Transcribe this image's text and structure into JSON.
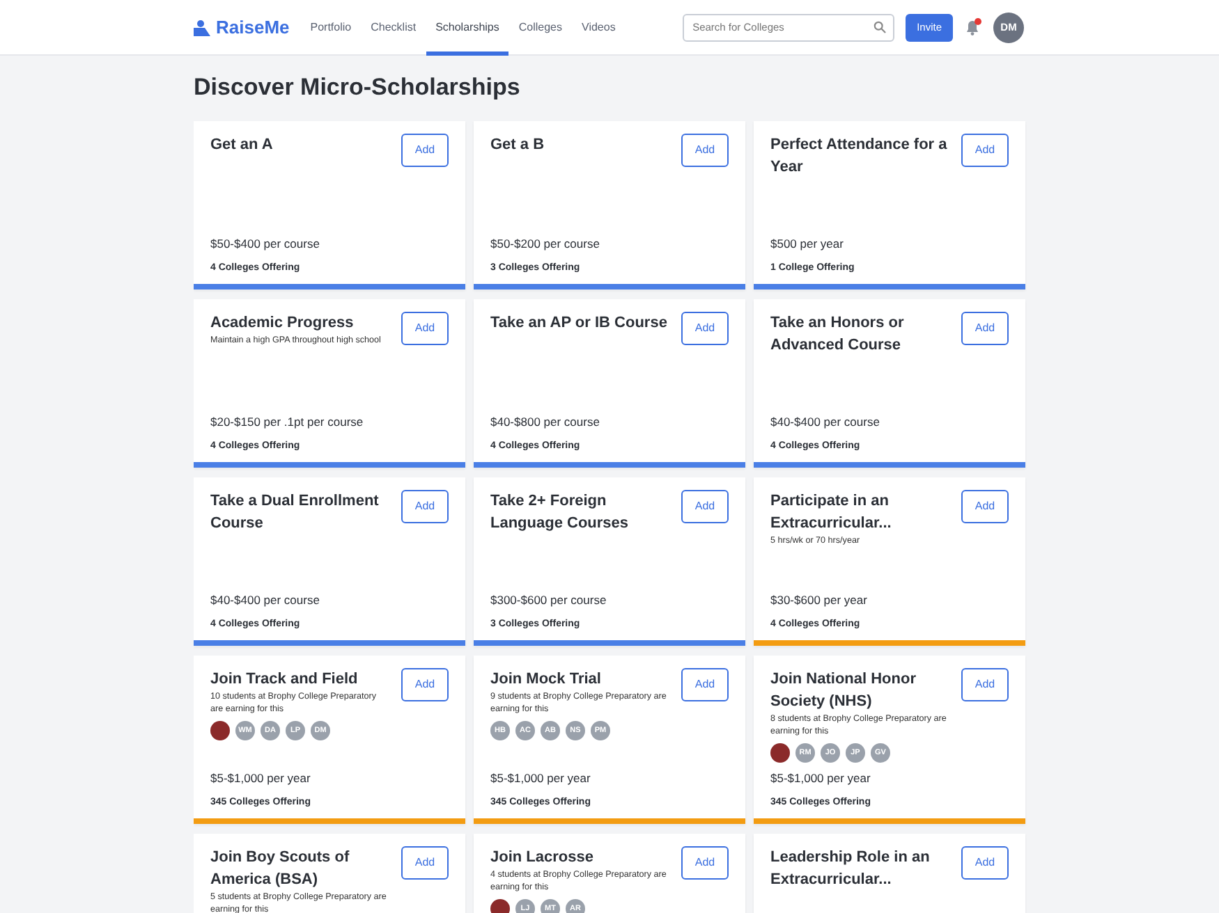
{
  "brand": "RaiseMe",
  "nav": [
    {
      "label": "Portfolio",
      "selected": false
    },
    {
      "label": "Checklist",
      "selected": false
    },
    {
      "label": "Scholarships",
      "selected": true
    },
    {
      "label": "Colleges",
      "selected": false
    },
    {
      "label": "Videos",
      "selected": false
    }
  ],
  "search": {
    "placeholder": "Search for Colleges"
  },
  "invite": "Invite",
  "notifications": {
    "unread": true
  },
  "user_initials": "DM",
  "heading": "Discover Micro-Scholarships",
  "cards": [
    {
      "title": "Get an A",
      "button": "Add",
      "amount": "$50-$400 per course",
      "offering": "4 Colleges Offering",
      "color": "#4a7fe6"
    },
    {
      "title": "Get a B",
      "button": "Add",
      "amount": "$50-$200 per course",
      "offering": "3 Colleges Offering",
      "color": "#4a7fe6"
    },
    {
      "title": "Perfect Attendance for a Year",
      "button": "Add",
      "amount": "$500 per year",
      "offering": "1 College Offering",
      "color": "#4a7fe6"
    },
    {
      "title": "Academic Progress",
      "subtitle": "Maintain a high GPA throughout high school",
      "button": "Add",
      "amount": "$20-$150 per .1pt per course",
      "offering": "4 Colleges Offering",
      "color": "#4a7fe6"
    },
    {
      "title": "Take an AP or IB Course",
      "button": "Add",
      "amount": "$40-$800 per course",
      "offering": "4 Colleges Offering",
      "color": "#4a7fe6"
    },
    {
      "title": "Take an Honors or Advanced Course",
      "button": "Add",
      "amount": "$40-$400 per course",
      "offering": "4 Colleges Offering",
      "color": "#4a7fe6"
    },
    {
      "title": "Take a Dual Enrollment Course",
      "button": "Add",
      "amount": "$40-$400 per course",
      "offering": "4 Colleges Offering",
      "color": "#4a7fe6"
    },
    {
      "title": "Take 2+ Foreign Language Courses",
      "button": "Add",
      "amount": "$300-$600 per course",
      "offering": "3 Colleges Offering",
      "color": "#4a7fe6"
    },
    {
      "title": "Participate in an Extracurricular...",
      "subtitle": "5 hrs/wk or 70 hrs/year",
      "button": "Add",
      "amount": "$30-$600 per year",
      "offering": "4 Colleges Offering",
      "color": "#f39c12"
    },
    {
      "title": "Join Track and Field",
      "subtitle": "10 students at Brophy College Preparatory are earning for this",
      "avatars": [
        {
          "kind": "photo"
        },
        {
          "kind": "initials",
          "text": "WM"
        },
        {
          "kind": "initials",
          "text": "DA"
        },
        {
          "kind": "initials",
          "text": "LP"
        },
        {
          "kind": "initials",
          "text": "DM"
        }
      ],
      "button": "Add",
      "amount": "$5-$1,000 per year",
      "offering": "345 Colleges Offering",
      "color": "#f39c12"
    },
    {
      "title": "Join Mock Trial",
      "subtitle": "9 students at Brophy College Preparatory are earning for this",
      "avatars": [
        {
          "kind": "initials",
          "text": "HB"
        },
        {
          "kind": "initials",
          "text": "AC"
        },
        {
          "kind": "initials",
          "text": "AB"
        },
        {
          "kind": "initials",
          "text": "NS"
        },
        {
          "kind": "initials",
          "text": "PM"
        }
      ],
      "button": "Add",
      "amount": "$5-$1,000 per year",
      "offering": "345 Colleges Offering",
      "color": "#f39c12"
    },
    {
      "title": "Join National Honor Society (NHS)",
      "subtitle": "8 students at Brophy College Preparatory are earning for this",
      "avatars": [
        {
          "kind": "photo"
        },
        {
          "kind": "initials",
          "text": "RM"
        },
        {
          "kind": "initials",
          "text": "JO"
        },
        {
          "kind": "initials",
          "text": "JP"
        },
        {
          "kind": "initials",
          "text": "GV"
        }
      ],
      "button": "Add",
      "amount": "$5-$1,000 per year",
      "offering": "345 Colleges Offering",
      "color": "#f39c12"
    },
    {
      "title": "Join Boy Scouts of America (BSA)",
      "subtitle": "5 students at Brophy College Preparatory are earning for this",
      "button": "Add"
    },
    {
      "title": "Join Lacrosse",
      "subtitle": "4 students at Brophy College Preparatory are earning for this",
      "avatars": [
        {
          "kind": "photo"
        },
        {
          "kind": "initials",
          "text": "LJ"
        },
        {
          "kind": "initials",
          "text": "MT"
        },
        {
          "kind": "initials",
          "text": "AR"
        }
      ],
      "button": "Add"
    },
    {
      "title": "Leadership Role in an Extracurricular...",
      "button": "Add"
    }
  ]
}
